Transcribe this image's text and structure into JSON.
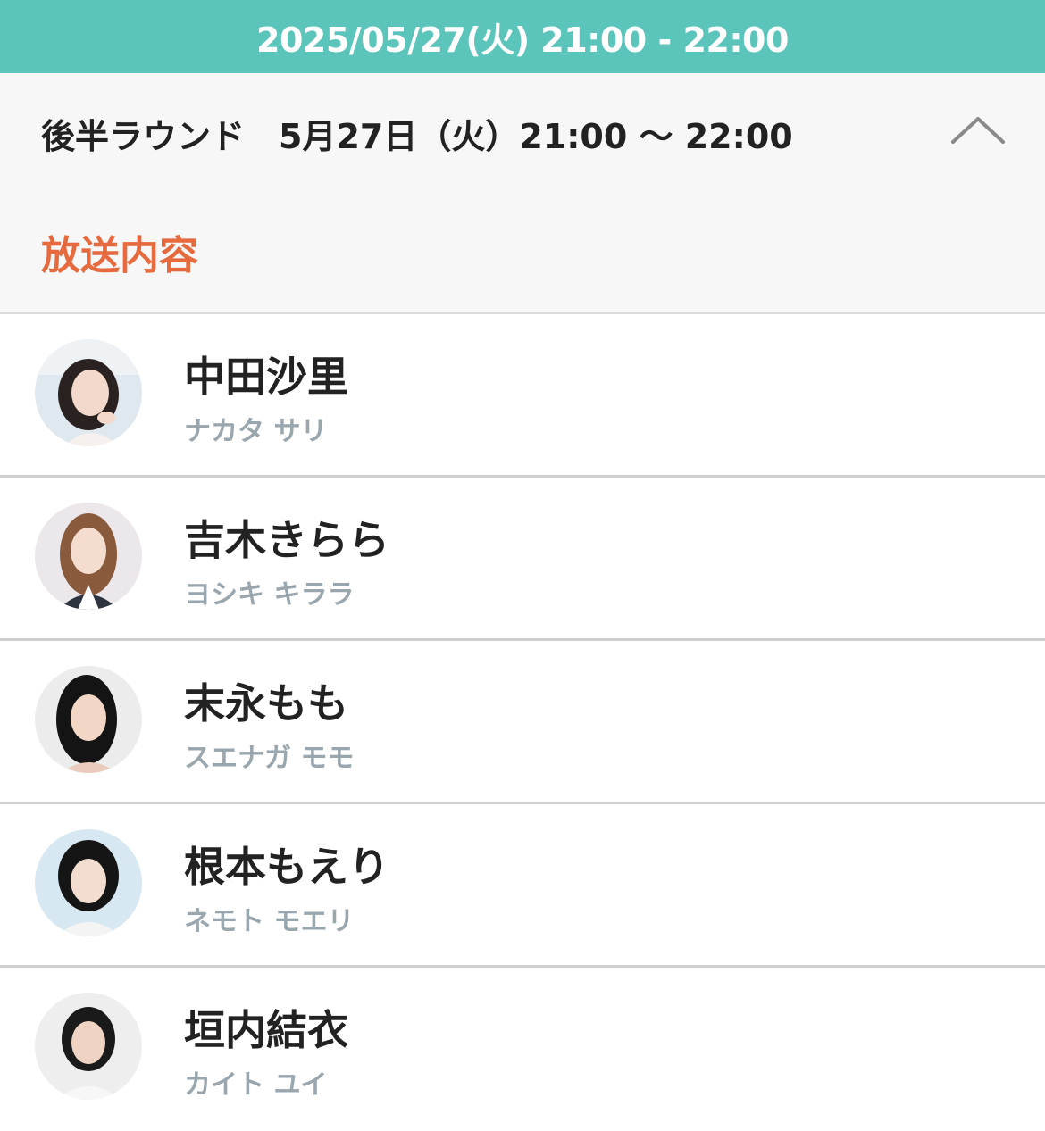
{
  "header": {
    "datetime": "2025/05/27(火) 21:00 - 22:00"
  },
  "round": {
    "title": "後半ラウンド　5月27日（火）21:00 〜 22:00",
    "expanded": true,
    "toggle_icon": "chevron-up-icon"
  },
  "section": {
    "label": "放送内容"
  },
  "colors": {
    "accent_teal": "#5bc4bb",
    "accent_orange": "#e66a3e",
    "kana_gray": "#9aa6ad"
  },
  "performers": [
    {
      "name": "中田沙里",
      "kana": "ナカタ サリ"
    },
    {
      "name": "吉木きらら",
      "kana": "ヨシキ キララ"
    },
    {
      "name": "末永もも",
      "kana": "スエナガ モモ"
    },
    {
      "name": "根本もえり",
      "kana": "ネモト モエリ"
    },
    {
      "name": "垣内結衣",
      "kana": "カイト ユイ"
    }
  ]
}
